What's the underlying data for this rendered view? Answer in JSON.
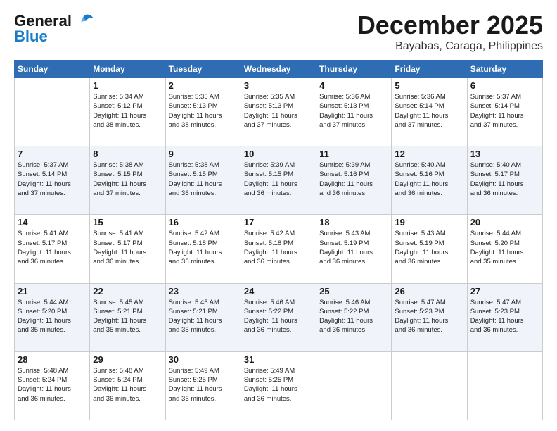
{
  "logo": {
    "line1": "General",
    "line2": "Blue"
  },
  "header": {
    "month": "December 2025",
    "location": "Bayabas, Caraga, Philippines"
  },
  "weekdays": [
    "Sunday",
    "Monday",
    "Tuesday",
    "Wednesday",
    "Thursday",
    "Friday",
    "Saturday"
  ],
  "weeks": [
    [
      {
        "day": "",
        "info": ""
      },
      {
        "day": "1",
        "info": "Sunrise: 5:34 AM\nSunset: 5:12 PM\nDaylight: 11 hours\nand 38 minutes."
      },
      {
        "day": "2",
        "info": "Sunrise: 5:35 AM\nSunset: 5:13 PM\nDaylight: 11 hours\nand 38 minutes."
      },
      {
        "day": "3",
        "info": "Sunrise: 5:35 AM\nSunset: 5:13 PM\nDaylight: 11 hours\nand 37 minutes."
      },
      {
        "day": "4",
        "info": "Sunrise: 5:36 AM\nSunset: 5:13 PM\nDaylight: 11 hours\nand 37 minutes."
      },
      {
        "day": "5",
        "info": "Sunrise: 5:36 AM\nSunset: 5:14 PM\nDaylight: 11 hours\nand 37 minutes."
      },
      {
        "day": "6",
        "info": "Sunrise: 5:37 AM\nSunset: 5:14 PM\nDaylight: 11 hours\nand 37 minutes."
      }
    ],
    [
      {
        "day": "7",
        "info": "Sunrise: 5:37 AM\nSunset: 5:14 PM\nDaylight: 11 hours\nand 37 minutes."
      },
      {
        "day": "8",
        "info": "Sunrise: 5:38 AM\nSunset: 5:15 PM\nDaylight: 11 hours\nand 37 minutes."
      },
      {
        "day": "9",
        "info": "Sunrise: 5:38 AM\nSunset: 5:15 PM\nDaylight: 11 hours\nand 36 minutes."
      },
      {
        "day": "10",
        "info": "Sunrise: 5:39 AM\nSunset: 5:15 PM\nDaylight: 11 hours\nand 36 minutes."
      },
      {
        "day": "11",
        "info": "Sunrise: 5:39 AM\nSunset: 5:16 PM\nDaylight: 11 hours\nand 36 minutes."
      },
      {
        "day": "12",
        "info": "Sunrise: 5:40 AM\nSunset: 5:16 PM\nDaylight: 11 hours\nand 36 minutes."
      },
      {
        "day": "13",
        "info": "Sunrise: 5:40 AM\nSunset: 5:17 PM\nDaylight: 11 hours\nand 36 minutes."
      }
    ],
    [
      {
        "day": "14",
        "info": "Sunrise: 5:41 AM\nSunset: 5:17 PM\nDaylight: 11 hours\nand 36 minutes."
      },
      {
        "day": "15",
        "info": "Sunrise: 5:41 AM\nSunset: 5:17 PM\nDaylight: 11 hours\nand 36 minutes."
      },
      {
        "day": "16",
        "info": "Sunrise: 5:42 AM\nSunset: 5:18 PM\nDaylight: 11 hours\nand 36 minutes."
      },
      {
        "day": "17",
        "info": "Sunrise: 5:42 AM\nSunset: 5:18 PM\nDaylight: 11 hours\nand 36 minutes."
      },
      {
        "day": "18",
        "info": "Sunrise: 5:43 AM\nSunset: 5:19 PM\nDaylight: 11 hours\nand 36 minutes."
      },
      {
        "day": "19",
        "info": "Sunrise: 5:43 AM\nSunset: 5:19 PM\nDaylight: 11 hours\nand 36 minutes."
      },
      {
        "day": "20",
        "info": "Sunrise: 5:44 AM\nSunset: 5:20 PM\nDaylight: 11 hours\nand 35 minutes."
      }
    ],
    [
      {
        "day": "21",
        "info": "Sunrise: 5:44 AM\nSunset: 5:20 PM\nDaylight: 11 hours\nand 35 minutes."
      },
      {
        "day": "22",
        "info": "Sunrise: 5:45 AM\nSunset: 5:21 PM\nDaylight: 11 hours\nand 35 minutes."
      },
      {
        "day": "23",
        "info": "Sunrise: 5:45 AM\nSunset: 5:21 PM\nDaylight: 11 hours\nand 35 minutes."
      },
      {
        "day": "24",
        "info": "Sunrise: 5:46 AM\nSunset: 5:22 PM\nDaylight: 11 hours\nand 36 minutes."
      },
      {
        "day": "25",
        "info": "Sunrise: 5:46 AM\nSunset: 5:22 PM\nDaylight: 11 hours\nand 36 minutes."
      },
      {
        "day": "26",
        "info": "Sunrise: 5:47 AM\nSunset: 5:23 PM\nDaylight: 11 hours\nand 36 minutes."
      },
      {
        "day": "27",
        "info": "Sunrise: 5:47 AM\nSunset: 5:23 PM\nDaylight: 11 hours\nand 36 minutes."
      }
    ],
    [
      {
        "day": "28",
        "info": "Sunrise: 5:48 AM\nSunset: 5:24 PM\nDaylight: 11 hours\nand 36 minutes."
      },
      {
        "day": "29",
        "info": "Sunrise: 5:48 AM\nSunset: 5:24 PM\nDaylight: 11 hours\nand 36 minutes."
      },
      {
        "day": "30",
        "info": "Sunrise: 5:49 AM\nSunset: 5:25 PM\nDaylight: 11 hours\nand 36 minutes."
      },
      {
        "day": "31",
        "info": "Sunrise: 5:49 AM\nSunset: 5:25 PM\nDaylight: 11 hours\nand 36 minutes."
      },
      {
        "day": "",
        "info": ""
      },
      {
        "day": "",
        "info": ""
      },
      {
        "day": "",
        "info": ""
      }
    ]
  ]
}
